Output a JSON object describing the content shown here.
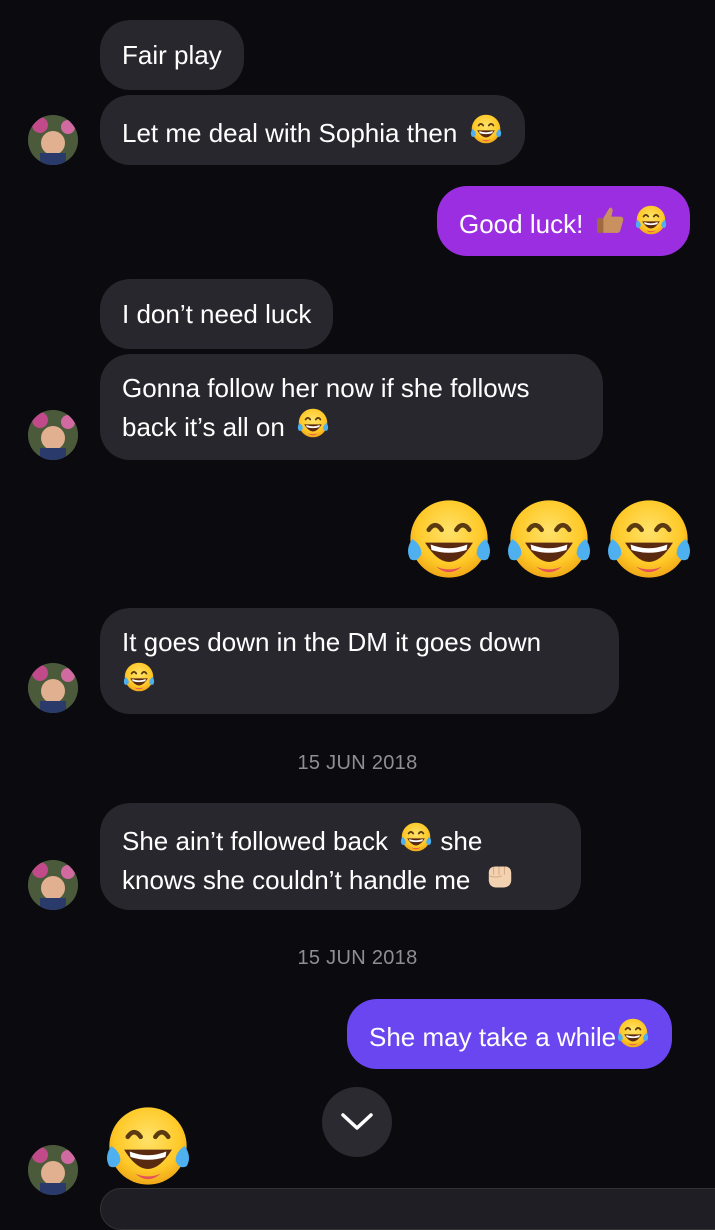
{
  "messages": [
    {
      "id": "m1",
      "text": "Fair play"
    },
    {
      "id": "m2",
      "text": "Let me deal with Sophia then",
      "emoji": "face-with-tears-of-joy"
    },
    {
      "id": "m3",
      "text": "Good luck!",
      "emoji": "thumbs-up-medium-skin + face-with-tears-of-joy",
      "sender": "me"
    },
    {
      "id": "m4",
      "text": "I don’t need luck"
    },
    {
      "id": "m5",
      "line1": "Gonna follow her now if she follows",
      "line2": "back it’s all on",
      "emoji": "face-with-tears-of-joy"
    },
    {
      "id": "m6",
      "emoji_only": "face-with-tears-of-joy x3",
      "sender": "me"
    },
    {
      "id": "m7",
      "line1": "It goes down in the DM it goes down",
      "emoji": "face-with-tears-of-joy"
    },
    {
      "id": "m8",
      "line1": "She ain’t followed back",
      "line1_after": "she",
      "line2": "knows she couldn’t handle me",
      "emoji": "face-with-tears-of-joy + oncoming-fist"
    },
    {
      "id": "m9",
      "text": "She may take a while",
      "emoji": "face-with-tears-of-joy",
      "sender": "me"
    },
    {
      "id": "m10",
      "emoji_only": "face-with-tears-of-joy"
    }
  ],
  "dates": [
    "15 JUN 2018",
    "15 JUN 2018"
  ],
  "colors": {
    "background": "#0a0a0f",
    "incoming_bubble": "#27272d",
    "outgoing_purple": "#9a2ee0",
    "outgoing_blue_purple": "#6a46f0",
    "date_text": "#8e8e93"
  },
  "icons": {
    "scroll_down": "chevron-down-icon",
    "avatar": "avatar"
  }
}
